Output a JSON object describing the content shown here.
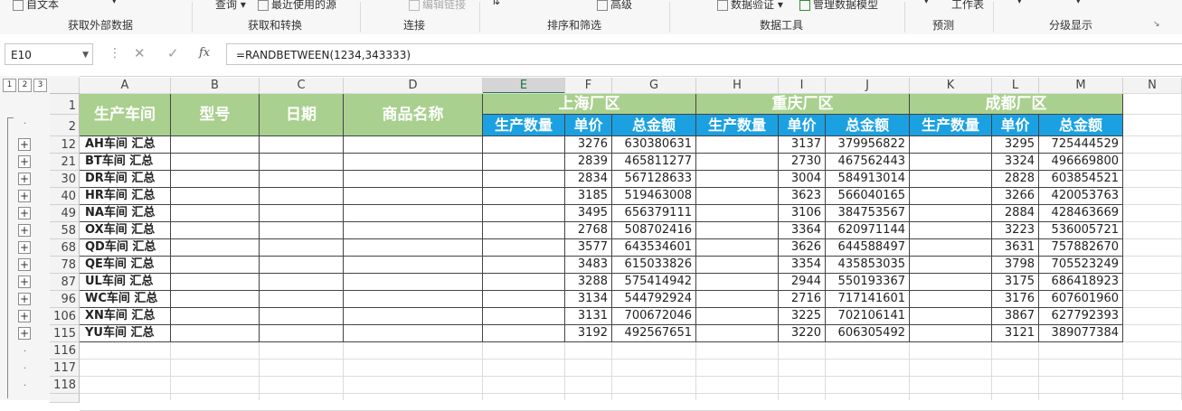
{
  "ribbon": {
    "items": [
      "自文本",
      "查询",
      "最近使用的源",
      "编辑链接",
      "高级",
      "数据验证",
      "管理数据模型",
      "工作表"
    ],
    "groups": [
      "获取外部数据",
      "获取和转换",
      "连接",
      "排序和筛选",
      "数据工具",
      "预测",
      "分级显示"
    ]
  },
  "formula_bar": {
    "name_box": "E10",
    "formula": "=RANDBETWEEN(1234,343333)",
    "fx": "fx"
  },
  "outline_levels": [
    "1",
    "2",
    "3"
  ],
  "columns": [
    "A",
    "B",
    "C",
    "D",
    "E",
    "F",
    "G",
    "H",
    "I",
    "J",
    "K",
    "L",
    "M",
    "N"
  ],
  "selected_column": "E",
  "header": {
    "merged": [
      "生产车间",
      "型号",
      "日期",
      "商品名称"
    ],
    "regions": [
      "上海厂区",
      "重庆厂区",
      "成都厂区"
    ],
    "sub": [
      "生产数量",
      "单价",
      "总金额"
    ]
  },
  "header_rows": [
    "1",
    "2"
  ],
  "rows": [
    {
      "row": "12",
      "label": "AH车间 汇总",
      "v": [
        "3276",
        "630380631",
        "3137",
        "379956822",
        "3295",
        "725444529"
      ]
    },
    {
      "row": "21",
      "label": "BT车间 汇总",
      "v": [
        "2839",
        "465811277",
        "2730",
        "467562443",
        "3324",
        "496669800"
      ]
    },
    {
      "row": "30",
      "label": "DR车间 汇总",
      "v": [
        "2834",
        "567128633",
        "3004",
        "584913014",
        "2828",
        "603854521"
      ]
    },
    {
      "row": "40",
      "label": "HR车间 汇总",
      "v": [
        "3185",
        "519463008",
        "3623",
        "566040165",
        "3266",
        "420053763"
      ]
    },
    {
      "row": "49",
      "label": "NA车间 汇总",
      "v": [
        "3495",
        "656379111",
        "3106",
        "384753567",
        "2884",
        "428463669"
      ]
    },
    {
      "row": "58",
      "label": "OX车间 汇总",
      "v": [
        "2768",
        "508702416",
        "3364",
        "620971144",
        "3223",
        "536005721"
      ]
    },
    {
      "row": "68",
      "label": "QD车间 汇总",
      "v": [
        "3577",
        "643534601",
        "3626",
        "644588497",
        "3631",
        "757882670"
      ]
    },
    {
      "row": "78",
      "label": "QE车间 汇总",
      "v": [
        "3483",
        "615033826",
        "3354",
        "435853035",
        "3798",
        "705523249"
      ]
    },
    {
      "row": "87",
      "label": "UL车间 汇总",
      "v": [
        "3288",
        "575414942",
        "2944",
        "550193367",
        "3175",
        "686418923"
      ]
    },
    {
      "row": "96",
      "label": "WC车间 汇总",
      "v": [
        "3134",
        "544792924",
        "2716",
        "717141601",
        "3176",
        "607601960"
      ]
    },
    {
      "row": "106",
      "label": "XN车间 汇总",
      "v": [
        "3131",
        "700672046",
        "3225",
        "702106141",
        "3867",
        "627792393"
      ]
    },
    {
      "row": "115",
      "label": "YU车间 汇总",
      "v": [
        "3192",
        "492567651",
        "3220",
        "606305492",
        "3121",
        "389077384"
      ]
    }
  ],
  "trailing_rows": [
    "116",
    "117",
    "118"
  ]
}
